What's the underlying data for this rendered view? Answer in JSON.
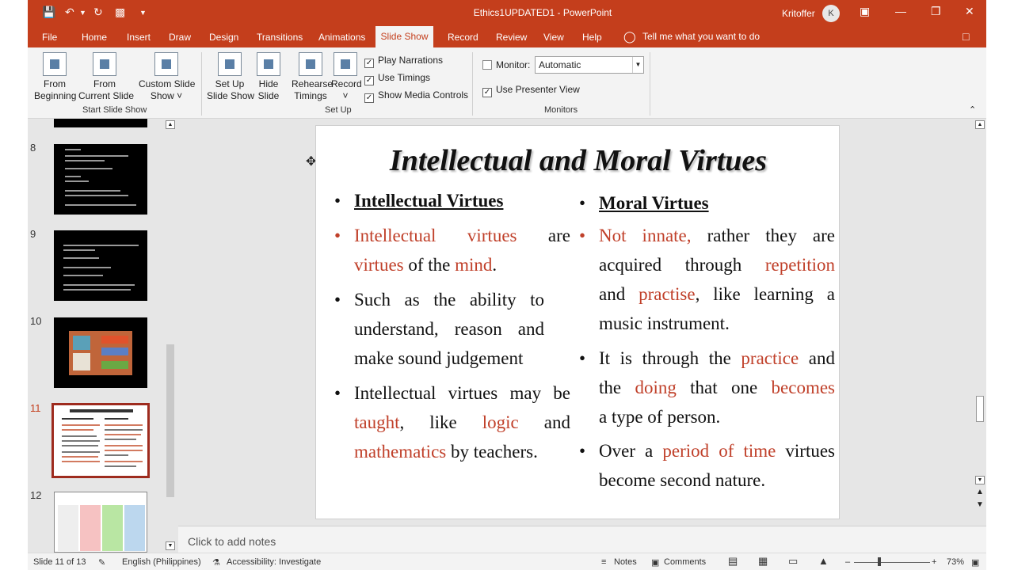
{
  "window": {
    "title": "Ethics1UPDATED1 - PowerPoint",
    "user": "Kritoffer",
    "avatar_initial": "K"
  },
  "tabs": [
    "File",
    "Home",
    "Insert",
    "Draw",
    "Design",
    "Transitions",
    "Animations",
    "Slide Show",
    "Record",
    "Review",
    "View",
    "Help"
  ],
  "active_tab": "Slide Show",
  "tell_me": "Tell me what you want to do",
  "ribbon": {
    "from_beginning": [
      "From",
      "Beginning"
    ],
    "from_current": [
      "From",
      "Current Slide"
    ],
    "custom_show": [
      "Custom Slide",
      "Show ˅"
    ],
    "group_start": "Start Slide Show",
    "setup_show": [
      "Set Up",
      "Slide Show"
    ],
    "hide_slide": [
      "Hide",
      "Slide"
    ],
    "rehearse": [
      "Rehearse",
      "Timings"
    ],
    "record": [
      "Record",
      "˅"
    ],
    "play_narrations": "Play Narrations",
    "use_timings": "Use Timings",
    "show_media": "Show Media Controls",
    "group_setup": "Set Up",
    "monitor_label": "Monitor:",
    "monitor_value": "Automatic",
    "presenter_view": "Use Presenter View",
    "group_monitors": "Monitors"
  },
  "thumbnails": [
    {
      "num": "8"
    },
    {
      "num": "9"
    },
    {
      "num": "10"
    },
    {
      "num": "11",
      "selected": true
    },
    {
      "num": "12"
    }
  ],
  "slide": {
    "title": "Intellectual and Moral Virtues",
    "left_heading": "Intellectual Virtues",
    "right_heading": "Moral Virtues"
  },
  "notes_placeholder": "Click to add notes",
  "status": {
    "slide_count": "Slide 11 of 13",
    "language": "English (Philippines)",
    "accessibility": "Accessibility: Investigate",
    "notes": "Notes",
    "comments": "Comments",
    "zoom": "73%"
  },
  "colors": {
    "accent": "#c43e1c",
    "highlight_text": "#c0402a"
  }
}
